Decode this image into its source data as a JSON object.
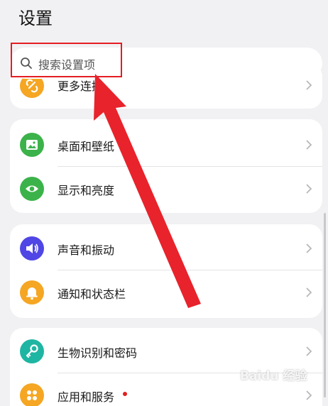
{
  "page": {
    "title": "设置"
  },
  "search": {
    "placeholder": "搜索设置项",
    "icon": "search-icon"
  },
  "colors": {
    "accent_red": "#e51c23",
    "more_connections_icon": "#f5a623",
    "wallpaper_icon": "#3bb34a",
    "display_icon": "#3bb34a",
    "sound_icon": "#4f46e5",
    "notification_icon": "#f5a623",
    "biometrics_icon": "#1fb5a3",
    "apps_icon": "#f5a623",
    "badge_dot": "#e02020"
  },
  "groups": [
    {
      "items": [
        {
          "label": "更多连接",
          "icon": "link-icon"
        }
      ]
    },
    {
      "items": [
        {
          "label": "桌面和壁纸",
          "icon": "image-icon"
        },
        {
          "label": "显示和亮度",
          "icon": "eye-icon"
        }
      ]
    },
    {
      "items": [
        {
          "label": "声音和振动",
          "icon": "speaker-icon"
        },
        {
          "label": "通知和状态栏",
          "icon": "bell-icon"
        }
      ]
    },
    {
      "items": [
        {
          "label": "生物识别和密码",
          "icon": "key-icon"
        },
        {
          "label": "应用和服务",
          "icon": "apps-grid-icon",
          "badge": "dot"
        }
      ]
    }
  ],
  "watermark": {
    "text": "Baidu 经验"
  }
}
